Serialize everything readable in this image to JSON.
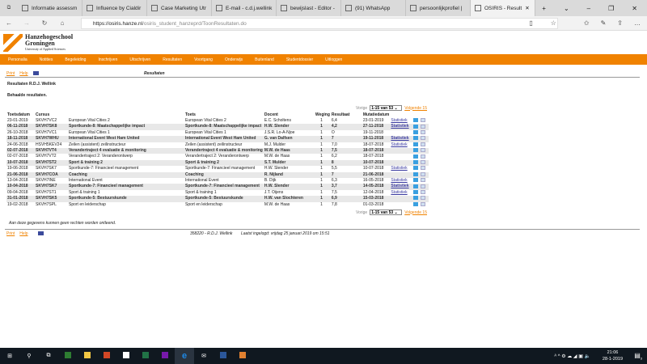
{
  "browser": {
    "tabs": [
      "Informatie assessm",
      "Influence by Cialdir",
      "Case Marketing Utr",
      "E-mail - c.d.j.wellink",
      "bewijslast - Editor -",
      "(91) WhatsApp",
      "persoonlijkprofiel |",
      "OSIRIS - Result"
    ],
    "url_host": "https://osiris.hanze.nl",
    "url_path": "/osiris_student_hanzeprd/ToonResultaten.do"
  },
  "logo": {
    "line1": "Hanzehogeschool",
    "line2": "Groningen",
    "line3": "University of Applied Sciences"
  },
  "menu": [
    "Personalia",
    "Notities",
    "Begeleiding",
    "Inschrijven",
    "Uitschrijven",
    "Resultaten",
    "Voortgang",
    "Onderwijs",
    "Buitenland",
    "Studentdossier",
    "Uitloggen"
  ],
  "toolbar": {
    "print": "Print",
    "help": "Help",
    "page_title": "Resultaten"
  },
  "content": {
    "heading": "Resultaten R.D.J. Wellink",
    "subheading": "Behaalde resultaten.",
    "disclaimer": "Aan deze gegevens kunnen geen rechten worden ontleend."
  },
  "pager": {
    "prev": "Vorige",
    "selected": "1-15 van 53",
    "next": "Volgende 15"
  },
  "table": {
    "headers": [
      "Toetsdatum",
      "Cursus",
      "",
      "Toets",
      "Docent",
      "Weging",
      "Resultaat",
      "Mutatiedatum"
    ],
    "stat_label": "Statistiek",
    "rows": [
      [
        "23-01-2019",
        "SKVH7VC2",
        "European Vital Cities 2",
        "European Vital Cities 2",
        "E.C. Scholtens",
        "1",
        "6,4",
        "23-01-2019",
        true
      ],
      [
        "06-11-2018",
        "SKVH7SK8",
        "Sportkunde-8: Maatschappelijke impact",
        "Sportkunde-8: Maatschappelijke impact",
        "H.W. Slender",
        "1",
        "4,2",
        "27-11-2018",
        true
      ],
      [
        "26-10-2018",
        "SKVH7VC1",
        "European Vital Cities 1",
        "European Vital Cities 1",
        "J.S.R. Lo-A-Njoe",
        "1",
        "O",
        "19-11-2018",
        false
      ],
      [
        "18-11-2018",
        "SKVH7WHU",
        "International Event West Ham United",
        "International Event West Ham United",
        "G. van Dalfsen",
        "1",
        "7",
        "19-11-2018",
        true
      ],
      [
        "24-06-2018",
        "HSVH5KEV24",
        "Zeilen (assistent) zeilinstructeur",
        "Zeilen (assistent) zeilinstructeur",
        "M.J. Mulder",
        "1",
        "7,0",
        "18-07-2018",
        true
      ],
      [
        "02-07-2018",
        "SKVH7VT4",
        "Verandertraject 4 evaluatie & monitoring",
        "Verandertraject 4 evaluatie & monitoring",
        "M.W. de Haas",
        "1",
        "7,5",
        "18-07-2018",
        false
      ],
      [
        "02-07-2018",
        "SKVH7VT2",
        "Verandertraject 2: Veranderontwerp",
        "Verandertraject 2: Veranderontwerp",
        "M.W. de Haas",
        "1",
        "6,2",
        "18-07-2018",
        false
      ],
      [
        "10-07-2018",
        "SKVH7ST2",
        "Sport & training 2",
        "Sport & training 2",
        "S.T. Mulder",
        "1",
        "8",
        "10-07-2018",
        false
      ],
      [
        "19-06-2018",
        "SKVH7SK7",
        "Sportkunde-7: Financieel management",
        "Sportkunde-7: Financieel management",
        "H.W. Slender",
        "1",
        "5,5",
        "10-07-2018",
        true
      ],
      [
        "21-06-2018",
        "SKVH7COA",
        "Coaching",
        "Coaching",
        "R. Nijland",
        "1",
        "7",
        "21-06-2018",
        false
      ],
      [
        "13-04-2018",
        "SKVH7INE",
        "International Event",
        "International Event",
        "B. Dijk",
        "1",
        "6,3",
        "16-05-2018",
        true
      ],
      [
        "10-04-2018",
        "SKVH7SK7",
        "Sportkunde-7: Financieel management",
        "Sportkunde-7: Financieel management",
        "H.W. Slender",
        "1",
        "3,7",
        "14-05-2018",
        true
      ],
      [
        "09-04-2018",
        "SKVH7ST1",
        "Sport & training 1",
        "Sport & training 1",
        "J.T. Oijens",
        "1",
        "7,5",
        "12-04-2018",
        true
      ],
      [
        "31-01-2018",
        "SKVH7SK5",
        "Sportkunde-5: Bestuurskunde",
        "Sportkunde-5: Bestuurskunde",
        "H.W. van Slochteren",
        "1",
        "6,9",
        "15-03-2018",
        false
      ],
      [
        "19-02-2018",
        "SKVH7SPL",
        "Sport en leiderschap",
        "Sport en leiderschap",
        "M.W. de Haas",
        "1",
        "7,8",
        "01-03-2018",
        false
      ]
    ]
  },
  "footer": {
    "print": "Print",
    "help": "Help",
    "user": "358220 - R.D.J. Wellink",
    "last_login": "Laatst ingelogd: vrijdag 25 januari 2019 om 15:51"
  },
  "taskbar": {
    "time": "21:06",
    "date": "28-1-2019",
    "notifications": "3"
  }
}
